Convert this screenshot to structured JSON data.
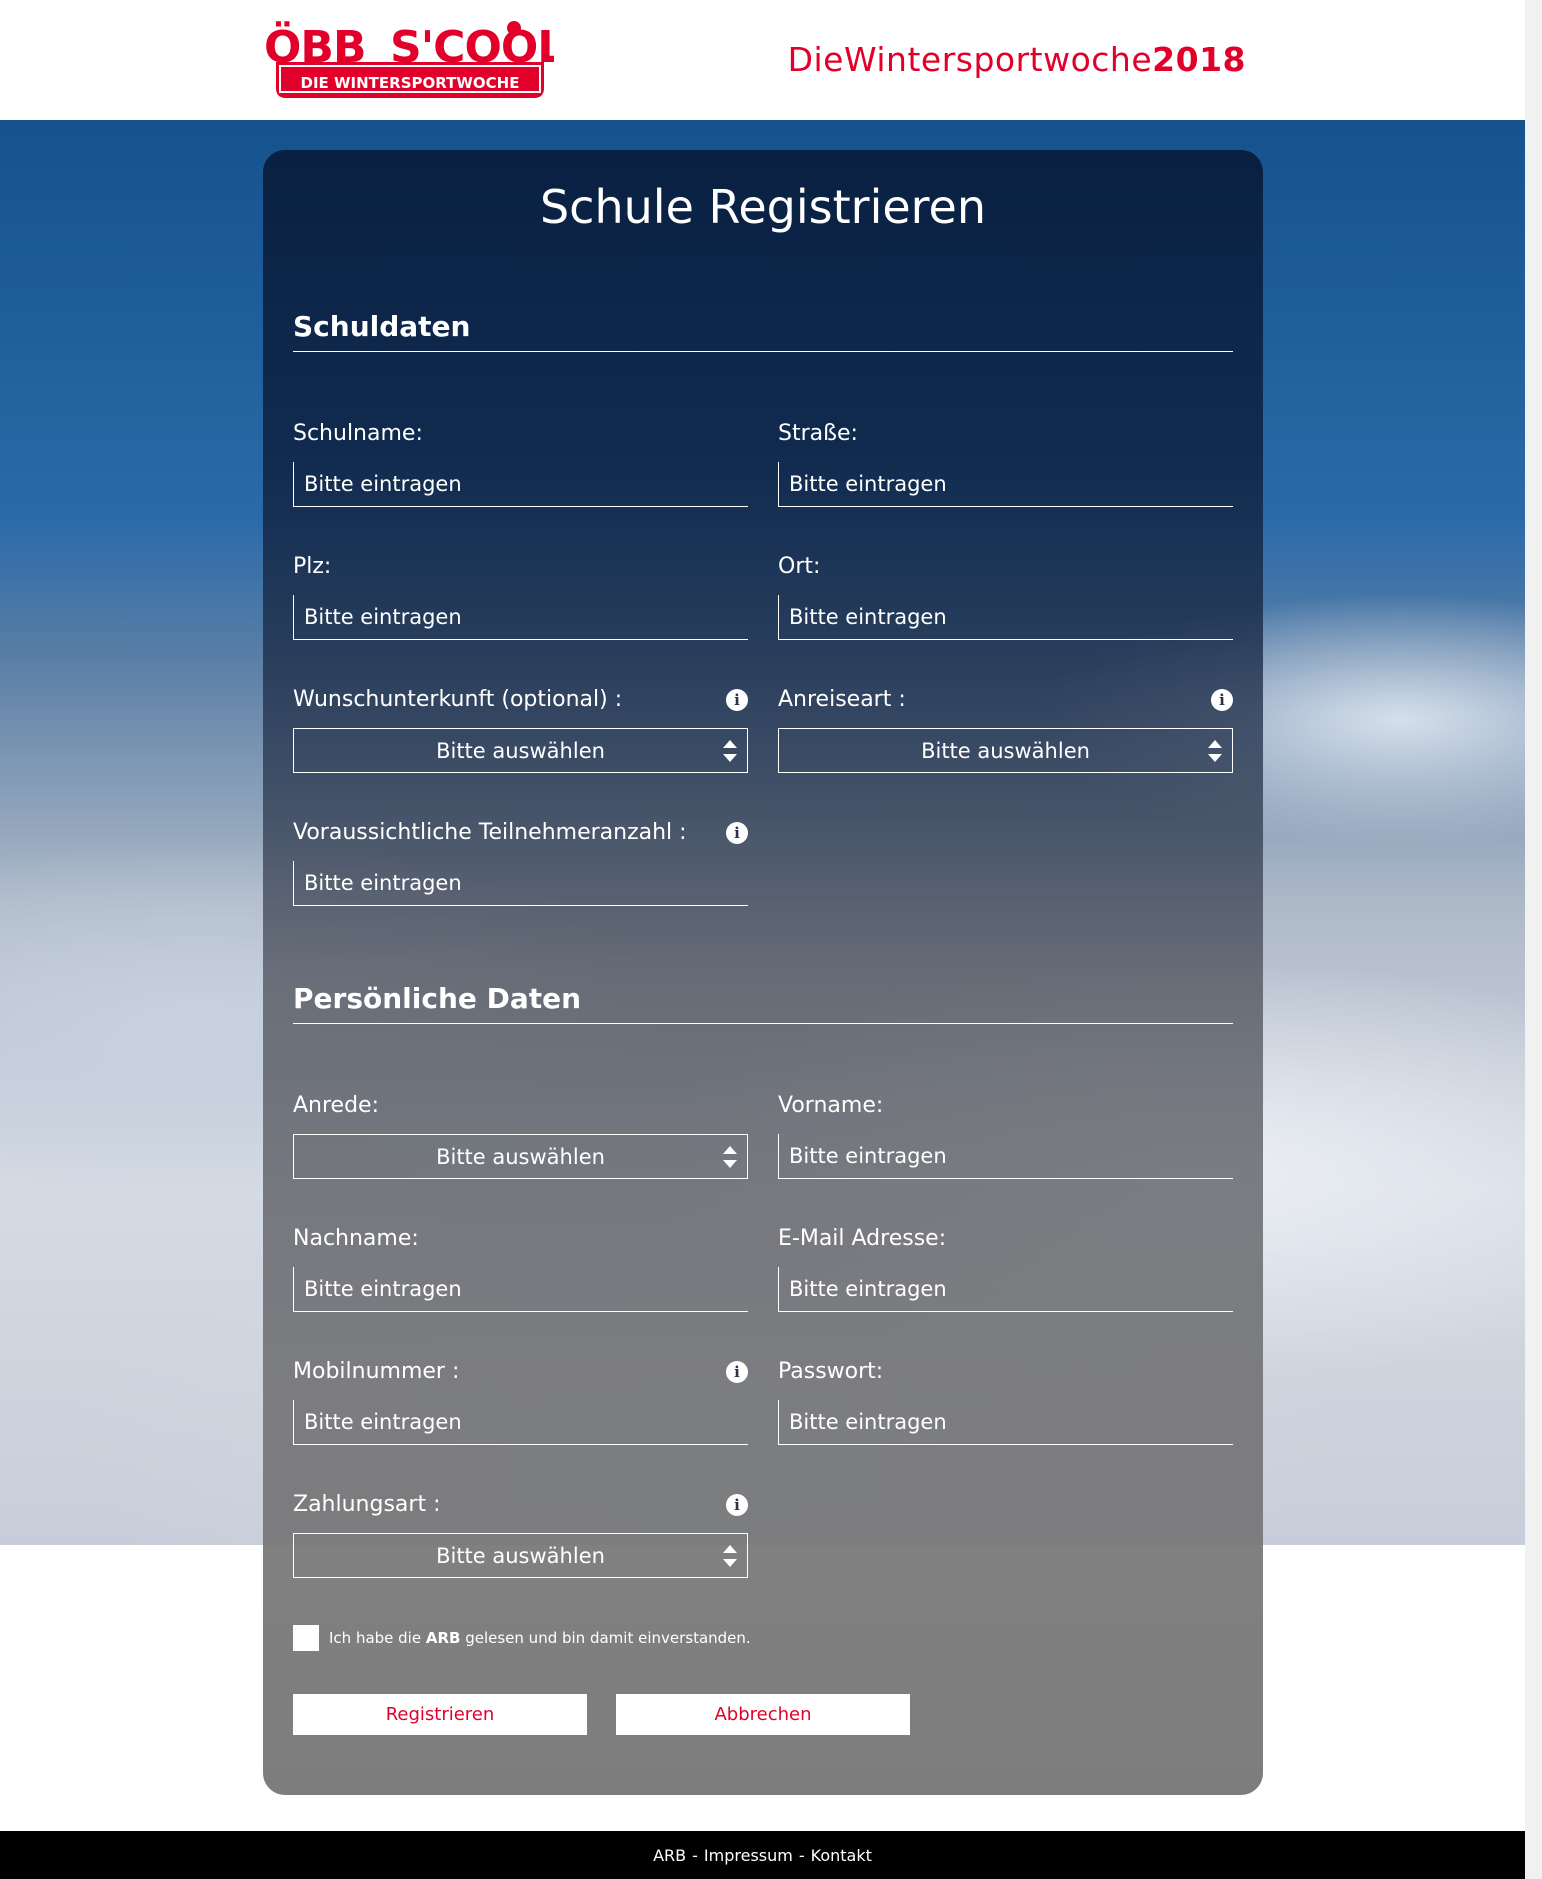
{
  "header": {
    "logo": {
      "brand_text": "ÖBB S'COOL",
      "sub_text": "DIE WINTERSPORTWOCHE",
      "brand_color": "#e2002a"
    },
    "tagline_prefix": "DieWintersportwoche",
    "tagline_year": "2018"
  },
  "form": {
    "title": "Schule Registrieren",
    "sections": {
      "school": {
        "title": "Schuldaten",
        "schulname": {
          "label": "Schulname:",
          "placeholder": "Bitte eintragen"
        },
        "strasse": {
          "label": "Straße:",
          "placeholder": "Bitte eintragen"
        },
        "plz": {
          "label": "Plz:",
          "placeholder": "Bitte eintragen"
        },
        "ort": {
          "label": "Ort:",
          "placeholder": "Bitte eintragen"
        },
        "unterkunft": {
          "label": "Wunschunterkunft (optional) :",
          "value": "Bitte auswählen"
        },
        "anreise": {
          "label": "Anreiseart :",
          "value": "Bitte auswählen"
        },
        "teilnehmer": {
          "label": "Voraussichtliche Teilnehmeranzahl :",
          "placeholder": "Bitte eintragen"
        }
      },
      "personal": {
        "title": "Persönliche Daten",
        "anrede": {
          "label": "Anrede:",
          "value": "Bitte auswählen"
        },
        "vorname": {
          "label": "Vorname:",
          "placeholder": "Bitte eintragen"
        },
        "nachname": {
          "label": "Nachname:",
          "placeholder": "Bitte eintragen"
        },
        "email": {
          "label": "E-Mail Adresse:",
          "placeholder": "Bitte eintragen"
        },
        "mobil": {
          "label": "Mobilnummer :",
          "placeholder": "Bitte eintragen"
        },
        "passwort": {
          "label": "Passwort:",
          "placeholder": "Bitte eintragen"
        },
        "zahlung": {
          "label": "Zahlungsart :",
          "value": "Bitte auswählen"
        }
      }
    },
    "consent": {
      "text_before": "Ich habe die ",
      "link": "ARB",
      "text_after": " gelesen und bin damit einverstanden."
    },
    "buttons": {
      "register": "Registrieren",
      "cancel": "Abbrechen"
    },
    "info_icon_glyph": "i"
  },
  "footer": {
    "links": [
      "ARB",
      "Impressum",
      "Kontakt"
    ],
    "separator": "-"
  },
  "colors": {
    "accent": "#e2002a",
    "footer_bg": "#000000"
  }
}
